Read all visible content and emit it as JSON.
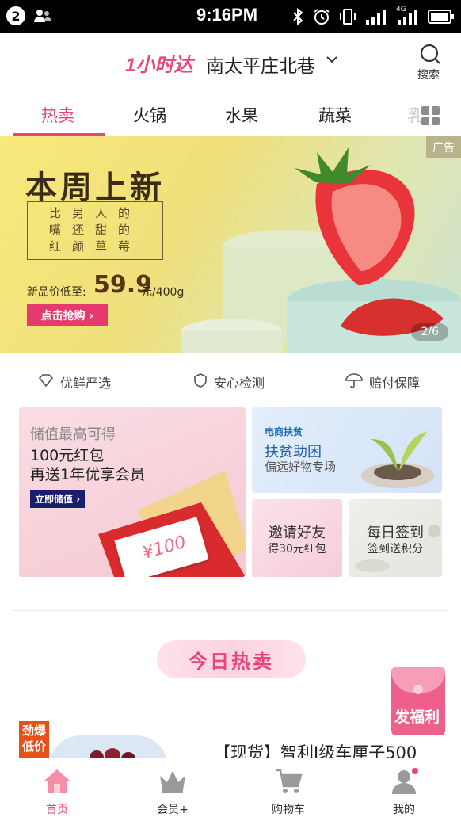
{
  "status_bar": {
    "notification_count": "2",
    "time": "9:16PM",
    "network": "4G"
  },
  "header": {
    "brand": "1小时达",
    "location": "南太平庄北巷",
    "search_label": "搜索"
  },
  "tabs": [
    {
      "label": "热卖",
      "active": true
    },
    {
      "label": "火锅",
      "active": false
    },
    {
      "label": "水果",
      "active": false
    },
    {
      "label": "蔬菜",
      "active": false
    },
    {
      "label": "乳",
      "active": false
    }
  ],
  "banner": {
    "ad_tag": "广告",
    "title": "本周上新",
    "box_lines": [
      "比男人的",
      "嘴还甜的",
      "红颜草莓"
    ],
    "price_label": "新品价低至:",
    "price": "59.9",
    "unit": "元/400g",
    "cta": "点击抢购 ›",
    "page_indicator": "2/6"
  },
  "features": [
    {
      "icon": "diamond-icon",
      "label": "优鲜严选"
    },
    {
      "icon": "shield-icon",
      "label": "安心检测"
    },
    {
      "icon": "umbrella-icon",
      "label": "赔付保障"
    }
  ],
  "promo": {
    "big": {
      "line1": "储值最高可得",
      "line2": "100元红包",
      "line3": "再送1年优享会员",
      "button": "立即储值 ›",
      "voucher_text": "¥100"
    },
    "poverty": {
      "logo": "电商扶贫",
      "title": "扶贫助困",
      "subtitle": "偏远好物专场"
    },
    "invite": {
      "title": "邀请好友",
      "subtitle": "得30元红包"
    },
    "checkin": {
      "title": "每日签到",
      "subtitle": "签到送积分"
    }
  },
  "section": {
    "today_hot": "今日热卖"
  },
  "float": {
    "welfare": "发福利"
  },
  "product": {
    "tag": "劲爆低价",
    "title": "【现货】智利J级车厘子500"
  },
  "bottom_nav": [
    {
      "label": "首页",
      "icon": "home-icon",
      "active": true
    },
    {
      "label": "会员+",
      "icon": "crown-icon",
      "active": false
    },
    {
      "label": "购物车",
      "icon": "cart-icon",
      "active": false
    },
    {
      "label": "我的",
      "icon": "user-icon",
      "active": false
    }
  ],
  "colors": {
    "accent": "#e8457a",
    "text": "#222222",
    "muted": "#888888"
  }
}
